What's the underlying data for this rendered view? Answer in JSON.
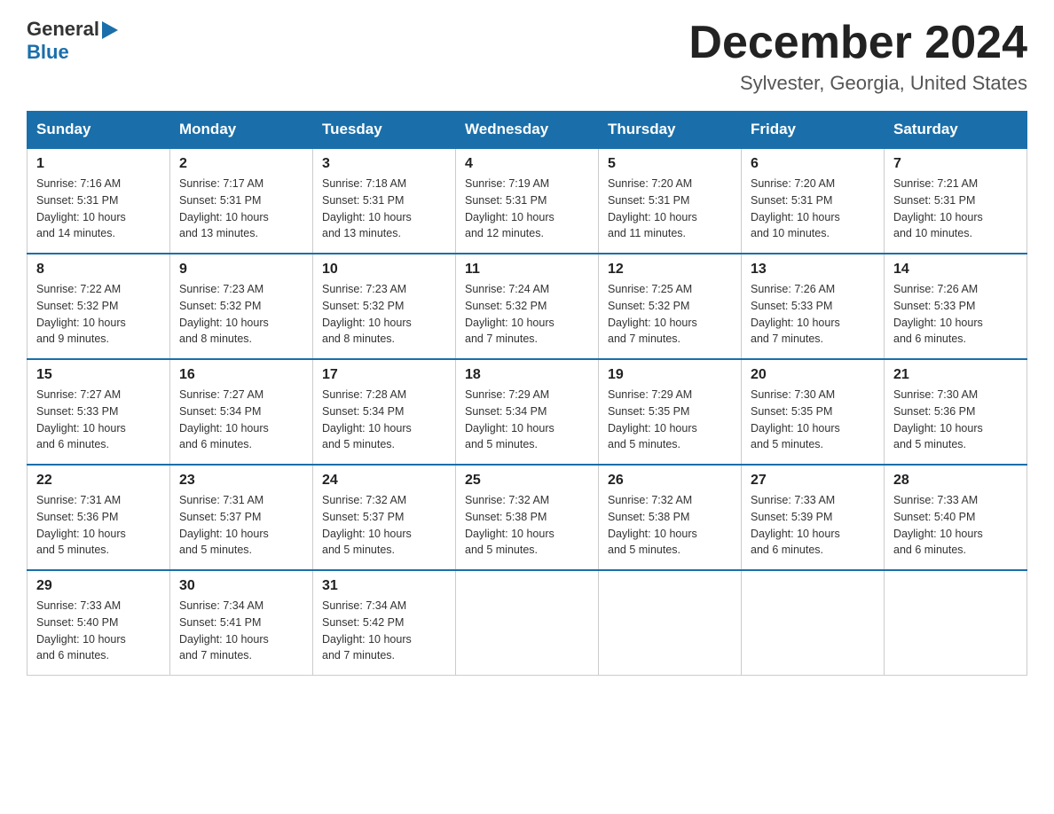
{
  "header": {
    "logo_general": "General",
    "logo_blue": "Blue",
    "month_title": "December 2024",
    "location": "Sylvester, Georgia, United States"
  },
  "weekdays": [
    "Sunday",
    "Monday",
    "Tuesday",
    "Wednesday",
    "Thursday",
    "Friday",
    "Saturday"
  ],
  "weeks": [
    [
      {
        "day": "1",
        "sunrise": "7:16 AM",
        "sunset": "5:31 PM",
        "daylight": "10 hours and 14 minutes."
      },
      {
        "day": "2",
        "sunrise": "7:17 AM",
        "sunset": "5:31 PM",
        "daylight": "10 hours and 13 minutes."
      },
      {
        "day": "3",
        "sunrise": "7:18 AM",
        "sunset": "5:31 PM",
        "daylight": "10 hours and 13 minutes."
      },
      {
        "day": "4",
        "sunrise": "7:19 AM",
        "sunset": "5:31 PM",
        "daylight": "10 hours and 12 minutes."
      },
      {
        "day": "5",
        "sunrise": "7:20 AM",
        "sunset": "5:31 PM",
        "daylight": "10 hours and 11 minutes."
      },
      {
        "day": "6",
        "sunrise": "7:20 AM",
        "sunset": "5:31 PM",
        "daylight": "10 hours and 10 minutes."
      },
      {
        "day": "7",
        "sunrise": "7:21 AM",
        "sunset": "5:31 PM",
        "daylight": "10 hours and 10 minutes."
      }
    ],
    [
      {
        "day": "8",
        "sunrise": "7:22 AM",
        "sunset": "5:32 PM",
        "daylight": "10 hours and 9 minutes."
      },
      {
        "day": "9",
        "sunrise": "7:23 AM",
        "sunset": "5:32 PM",
        "daylight": "10 hours and 8 minutes."
      },
      {
        "day": "10",
        "sunrise": "7:23 AM",
        "sunset": "5:32 PM",
        "daylight": "10 hours and 8 minutes."
      },
      {
        "day": "11",
        "sunrise": "7:24 AM",
        "sunset": "5:32 PM",
        "daylight": "10 hours and 7 minutes."
      },
      {
        "day": "12",
        "sunrise": "7:25 AM",
        "sunset": "5:32 PM",
        "daylight": "10 hours and 7 minutes."
      },
      {
        "day": "13",
        "sunrise": "7:26 AM",
        "sunset": "5:33 PM",
        "daylight": "10 hours and 7 minutes."
      },
      {
        "day": "14",
        "sunrise": "7:26 AM",
        "sunset": "5:33 PM",
        "daylight": "10 hours and 6 minutes."
      }
    ],
    [
      {
        "day": "15",
        "sunrise": "7:27 AM",
        "sunset": "5:33 PM",
        "daylight": "10 hours and 6 minutes."
      },
      {
        "day": "16",
        "sunrise": "7:27 AM",
        "sunset": "5:34 PM",
        "daylight": "10 hours and 6 minutes."
      },
      {
        "day": "17",
        "sunrise": "7:28 AM",
        "sunset": "5:34 PM",
        "daylight": "10 hours and 5 minutes."
      },
      {
        "day": "18",
        "sunrise": "7:29 AM",
        "sunset": "5:34 PM",
        "daylight": "10 hours and 5 minutes."
      },
      {
        "day": "19",
        "sunrise": "7:29 AM",
        "sunset": "5:35 PM",
        "daylight": "10 hours and 5 minutes."
      },
      {
        "day": "20",
        "sunrise": "7:30 AM",
        "sunset": "5:35 PM",
        "daylight": "10 hours and 5 minutes."
      },
      {
        "day": "21",
        "sunrise": "7:30 AM",
        "sunset": "5:36 PM",
        "daylight": "10 hours and 5 minutes."
      }
    ],
    [
      {
        "day": "22",
        "sunrise": "7:31 AM",
        "sunset": "5:36 PM",
        "daylight": "10 hours and 5 minutes."
      },
      {
        "day": "23",
        "sunrise": "7:31 AM",
        "sunset": "5:37 PM",
        "daylight": "10 hours and 5 minutes."
      },
      {
        "day": "24",
        "sunrise": "7:32 AM",
        "sunset": "5:37 PM",
        "daylight": "10 hours and 5 minutes."
      },
      {
        "day": "25",
        "sunrise": "7:32 AM",
        "sunset": "5:38 PM",
        "daylight": "10 hours and 5 minutes."
      },
      {
        "day": "26",
        "sunrise": "7:32 AM",
        "sunset": "5:38 PM",
        "daylight": "10 hours and 5 minutes."
      },
      {
        "day": "27",
        "sunrise": "7:33 AM",
        "sunset": "5:39 PM",
        "daylight": "10 hours and 6 minutes."
      },
      {
        "day": "28",
        "sunrise": "7:33 AM",
        "sunset": "5:40 PM",
        "daylight": "10 hours and 6 minutes."
      }
    ],
    [
      {
        "day": "29",
        "sunrise": "7:33 AM",
        "sunset": "5:40 PM",
        "daylight": "10 hours and 6 minutes."
      },
      {
        "day": "30",
        "sunrise": "7:34 AM",
        "sunset": "5:41 PM",
        "daylight": "10 hours and 7 minutes."
      },
      {
        "day": "31",
        "sunrise": "7:34 AM",
        "sunset": "5:42 PM",
        "daylight": "10 hours and 7 minutes."
      },
      null,
      null,
      null,
      null
    ]
  ],
  "labels": {
    "sunrise": "Sunrise:",
    "sunset": "Sunset:",
    "daylight": "Daylight:"
  }
}
